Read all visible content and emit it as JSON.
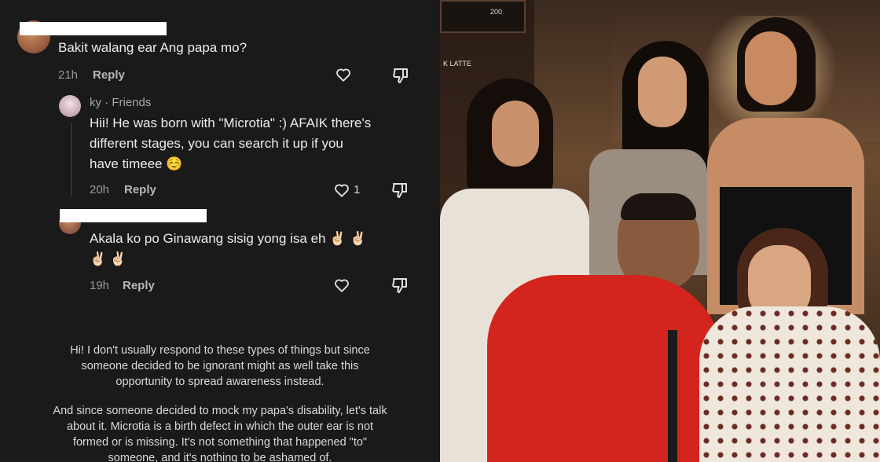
{
  "comments": [
    {
      "author_redacted": true,
      "text": "Bakit walang ear Ang papa mo?",
      "time": "21h",
      "reply_label": "Reply",
      "like_count": ""
    },
    {
      "author": "ky · Friends",
      "text_lines": [
        "Hii! He was born with \"Microtia\" :) AFAIK there's",
        "different stages, you can search it up if you",
        "have timeee ☺️"
      ],
      "time": "20h",
      "reply_label": "Reply",
      "like_count": "1"
    },
    {
      "author_redacted": true,
      "text_lines": [
        "Akala ko po Ginawang sisig yong isa eh ✌🏻 ✌🏻",
        "✌🏻 ✌🏻"
      ],
      "time": "19h",
      "reply_label": "Reply",
      "like_count": ""
    }
  ],
  "statement": {
    "paragraph1": [
      "Hi! I don't usually respond to these types of things but since",
      "someone decided to be ignorant might as well take this",
      "opportunity to spread awareness instead."
    ],
    "paragraph2": [
      "And since someone decided to mock my papa's disability, let's talk",
      "about it. Microtia is a birth defect in which the outer ear is not",
      "formed or is missing. It's not something that happened \"to\"",
      "someone, and it's nothing to be ashamed of."
    ]
  },
  "photo": {
    "sign_text": "200",
    "sign2_text": "K LATTE"
  },
  "icons": {
    "like": "heart-icon",
    "dislike": "thumbs-down-icon"
  }
}
